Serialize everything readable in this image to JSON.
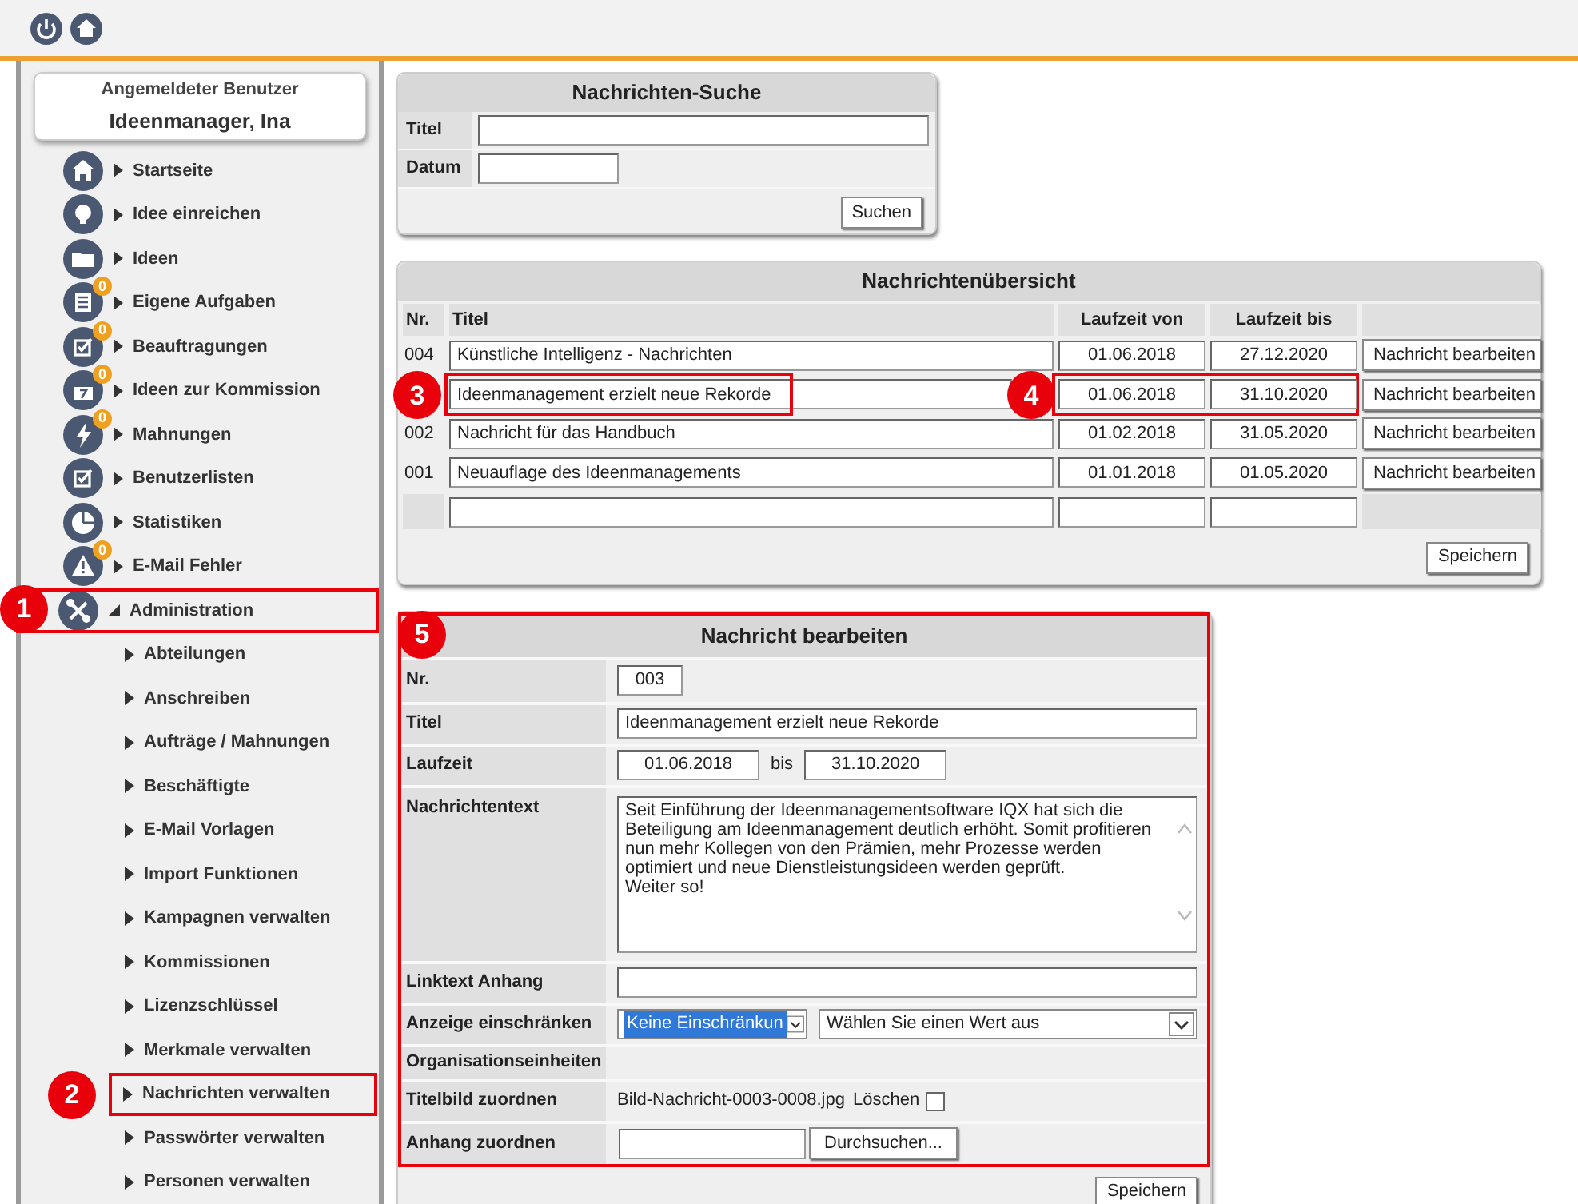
{
  "toolbar": {
    "buttons": [
      {
        "kind": "power"
      },
      {
        "kind": "home"
      }
    ]
  },
  "user_box": {
    "label": "Angemeldeter Benutzer",
    "name": "Ideenmanager, Ina"
  },
  "menu": [
    {
      "label": "Startseite",
      "expanded": false
    },
    {
      "label": "Idee einreichen",
      "expanded": false
    },
    {
      "label": "Ideen",
      "expanded": false
    },
    {
      "label": "Eigene Aufgaben",
      "badge": "0",
      "expanded": false
    },
    {
      "label": "Beauftragungen",
      "badge": "0",
      "expanded": false
    },
    {
      "label": "Ideen zur Kommission",
      "badge": "0",
      "expanded": false
    },
    {
      "label": "Mahnungen",
      "badge": "0",
      "expanded": false
    },
    {
      "label": "Benutzerlisten",
      "expanded": false
    },
    {
      "label": "Statistiken",
      "expanded": false
    },
    {
      "label": "E-Mail Fehler",
      "badge": "0",
      "expanded": false
    },
    {
      "label": "Administration",
      "expanded": true,
      "callout": "1",
      "children": [
        {
          "label": "Abteilungen"
        },
        {
          "label": "Anschreiben"
        },
        {
          "label": "Aufträge / Mahnungen"
        },
        {
          "label": "Beschäftigte"
        },
        {
          "label": "E-Mail Vorlagen"
        },
        {
          "label": "Import Funktionen"
        },
        {
          "label": "Kampagnen verwalten"
        },
        {
          "label": "Kommissionen"
        },
        {
          "label": "Lizenzschlüssel"
        },
        {
          "label": "Merkmale verwalten"
        },
        {
          "label": "Nachrichten verwalten",
          "callout": "2"
        },
        {
          "label": "Passwörter verwalten"
        },
        {
          "label": "Personen verwalten"
        }
      ]
    }
  ],
  "search": {
    "title": "Nachrichten-Suche",
    "fields": [
      {
        "label": "Titel",
        "kind": "wide"
      },
      {
        "label": "Datum",
        "kind": "short"
      }
    ],
    "button": "Suchen"
  },
  "overview": {
    "title": "Nachrichtenübersicht",
    "columns": [
      "Nr.",
      "Titel",
      "Laufzeit von",
      "Laufzeit bis"
    ],
    "rows": [
      {
        "nr": "004",
        "title": "Künstliche Intelligenz - Nachrichten",
        "from": "01.06.2018",
        "to": "27.12.2020",
        "action": "Nachricht bearbeiten"
      },
      {
        "title": "Ideenmanagement erzielt neue Rekorde",
        "from": "01.06.2018",
        "to": "31.10.2020",
        "action": "Nachricht bearbeiten",
        "callout_title": "3",
        "callout_dates": "4"
      },
      {
        "nr": "002",
        "title": "Nachricht für das Handbuch",
        "from": "01.02.2018",
        "to": "31.05.2020",
        "action": "Nachricht bearbeiten"
      },
      {
        "nr": "001",
        "title": "Neuauflage des Ideenmanagements",
        "from": "01.01.2018",
        "to": "01.05.2020",
        "action": "Nachricht bearbeiten"
      }
    ],
    "button": "Speichern"
  },
  "edit": {
    "title": "Nachricht bearbeiten",
    "callout": "5",
    "fields": [
      {
        "label": "Nr.",
        "kind": "short",
        "value": "003"
      },
      {
        "label": "Titel",
        "kind": "text",
        "value": "Ideenmanagement erzielt neue Rekorde"
      },
      {
        "label": "Laufzeit",
        "kind": "range",
        "from": "01.06.2018",
        "separator": "bis",
        "to": "31.10.2020"
      },
      {
        "label": "Nachrichtentext",
        "kind": "textarea",
        "value": "Seit Einführung der Ideenmanagementsoftware IQX hat sich die Beteiligung am Ideenmanagement deutlich erhöht. Somit profitieren nun mehr Kollegen von den Prämien, mehr Prozesse werden optimiert und neue Dienstleistungsideen werden geprüft.\nWeiter so!"
      },
      {
        "label": "Linktext Anhang",
        "kind": "text"
      },
      {
        "label": "Anzeige einschränken",
        "kind": "selects",
        "value": "Keine Einschränkun",
        "value2": "Wählen Sie einen Wert aus"
      },
      {
        "label": "Organisationseinheiten",
        "kind": "empty"
      },
      {
        "label": "Titelbild zuordnen",
        "kind": "image",
        "value": "Bild-Nachricht-0003-0008.jpg",
        "delete_label": "Löschen",
        "checked": false
      },
      {
        "label": "Anhang zuordnen",
        "kind": "file",
        "button": "Durchsuchen..."
      }
    ],
    "button": "Speichern"
  }
}
